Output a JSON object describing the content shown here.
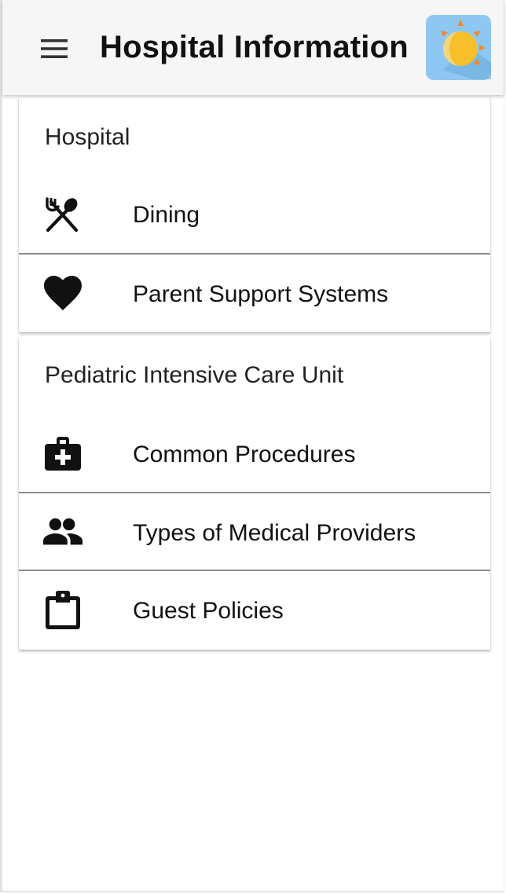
{
  "header": {
    "title": "Hospital Information",
    "menu_icon": "hamburger-menu-icon",
    "logo_icon": "sun-moon-logo"
  },
  "sections": [
    {
      "title": "Hospital",
      "items": [
        {
          "label": "Dining",
          "icon": "fork-spoon-icon"
        },
        {
          "label": "Parent Support Systems",
          "icon": "heart-icon"
        }
      ]
    },
    {
      "title": "Pediatric Intensive Care Unit",
      "items": [
        {
          "label": "Common Procedures",
          "icon": "medical-kit-icon"
        },
        {
          "label": "Types of Medical Providers",
          "icon": "people-icon"
        },
        {
          "label": "Guest Policies",
          "icon": "clipboard-icon"
        }
      ]
    }
  ],
  "colors": {
    "appbar_bg": "#f6f6f6",
    "logo_bg": "#8ec8f2",
    "logo_sun": "#f7bf2a",
    "logo_rays": "#f08a30"
  }
}
